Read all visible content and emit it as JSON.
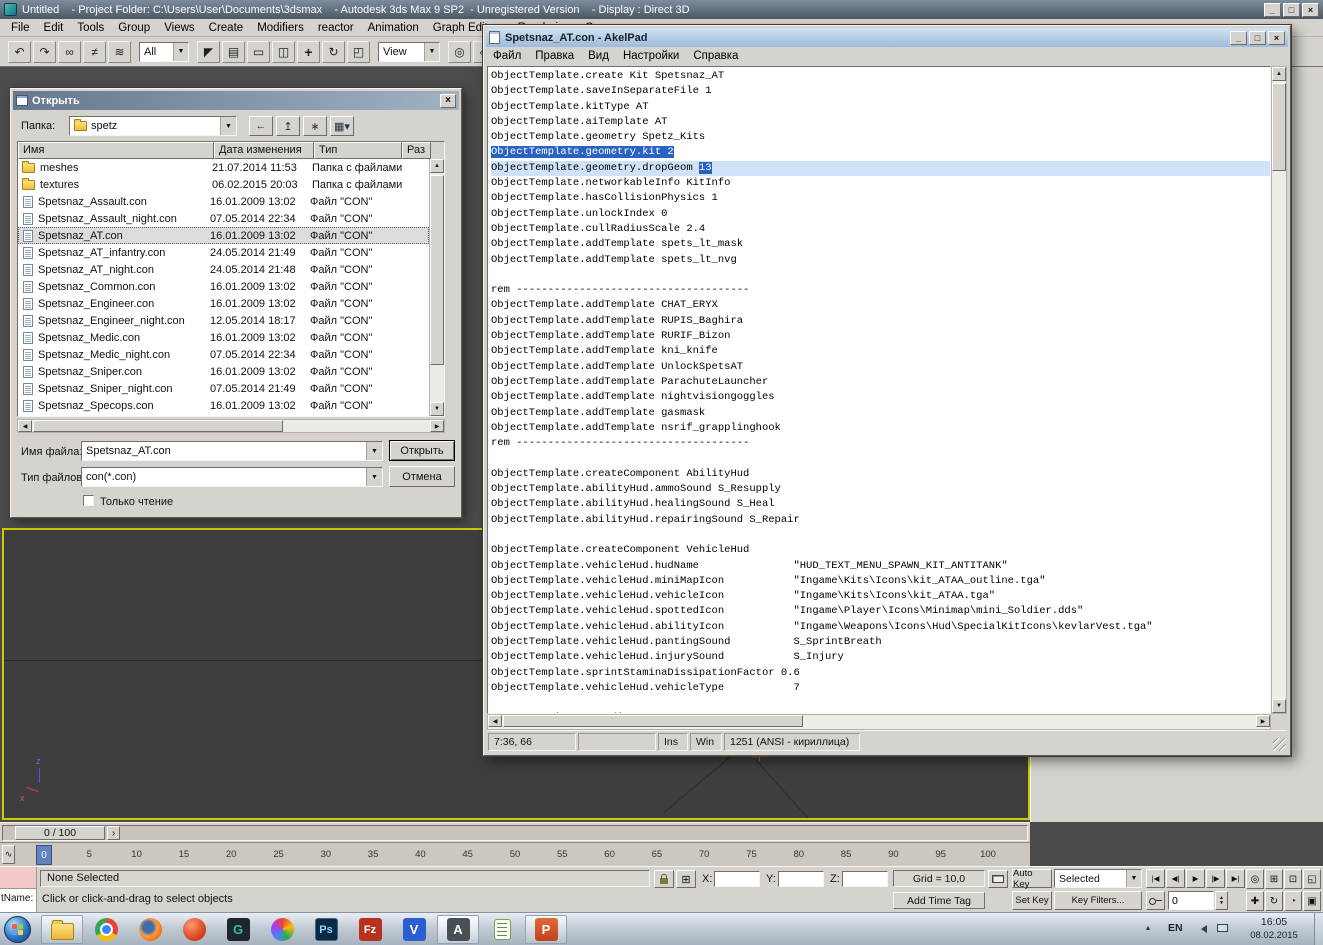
{
  "colors": {
    "selection_blue": "#2a62c4",
    "active_line_blue": "#cfe2f7",
    "viewport_active_border": "#cccc00"
  },
  "max_window": {
    "title": "Untitled    - Project Folder: C:\\Users\\User\\Documents\\3dsmax    - Autodesk 3ds Max 9 SP2  - Unregistered Version    - Display : Direct 3D",
    "window_buttons": {
      "minimize": "_",
      "maximize": "□",
      "close": "×"
    },
    "menu_items": [
      "File",
      "Edit",
      "Tools",
      "Group",
      "Views",
      "Create",
      "Modifiers",
      "reactor",
      "Animation",
      "Graph Editors",
      "Rendering",
      "Cu"
    ],
    "toolbar": {
      "group1": [
        {
          "name": "undo",
          "glyph": "↶"
        },
        {
          "name": "redo",
          "glyph": "↷"
        },
        {
          "name": "select-and-link",
          "glyph": "∞"
        },
        {
          "name": "unlink-selection",
          "glyph": "≠"
        },
        {
          "name": "bind-to-space-warp",
          "glyph": "≋"
        }
      ],
      "selection_filter_value": "All",
      "group2": [
        {
          "name": "select-object",
          "glyph": "◤"
        },
        {
          "name": "select-by-name",
          "glyph": "▤"
        },
        {
          "name": "rectangular-selection-region",
          "glyph": "▭"
        },
        {
          "name": "window-crossing-toggle",
          "glyph": "◫"
        },
        {
          "name": "select-and-move",
          "glyph": "+",
          "cls": "bold"
        },
        {
          "name": "select-and-rotate",
          "glyph": "↻"
        },
        {
          "name": "select-and-uniform-scale",
          "glyph": "◰"
        }
      ],
      "coordsys_value": "View",
      "group3": [
        {
          "name": "use-pivot-point-center",
          "glyph": "◎"
        },
        {
          "name": "select-and-manipulate",
          "glyph": "◇"
        }
      ]
    },
    "time_slider_label": "0 / 100",
    "trackbar": {
      "frame_marker": "0",
      "ticks": [
        5,
        10,
        15,
        20,
        25,
        30,
        35,
        40,
        45,
        50,
        55,
        60,
        65,
        70,
        75,
        80,
        85,
        90,
        95,
        100
      ]
    },
    "mini_listener_text": "tName: (bf",
    "status": {
      "selection_status": "None Selected",
      "prompt": "Click or click-and-drag to select objects",
      "x_label": "X:",
      "y_label": "Y:",
      "z_label": "Z:",
      "grid_value": "Grid = 10,0",
      "add_time_tag": "Add Time Tag",
      "auto_key": "Auto Key",
      "set_key": "Set Key",
      "key_mode_value": "Selected",
      "key_filters": "Key Filters...",
      "time_value": "0",
      "playback": [
        {
          "name": "go-to-start",
          "glyph": "|◀"
        },
        {
          "name": "previous-frame",
          "glyph": "◀|"
        },
        {
          "name": "play-animation",
          "glyph": "▶"
        },
        {
          "name": "next-frame",
          "glyph": "|▶"
        },
        {
          "name": "go-to-end",
          "glyph": "▶|"
        }
      ],
      "nav_row1": [
        {
          "name": "zoom",
          "glyph": "◎"
        },
        {
          "name": "zoom-all",
          "glyph": "⊞"
        },
        {
          "name": "zoom-extents",
          "glyph": "⊡"
        },
        {
          "name": "zoom-region",
          "glyph": "◱"
        }
      ],
      "nav_row2": [
        {
          "name": "pan-view",
          "glyph": "✚"
        },
        {
          "name": "orbit-view",
          "glyph": "↻"
        },
        {
          "name": "field-of-view",
          "glyph": "◔"
        },
        {
          "name": "maximize-viewport-toggle",
          "glyph": "▣"
        }
      ]
    },
    "viewport": {
      "axis_z": "z",
      "axis_x": "x"
    }
  },
  "open_dialog": {
    "title": "Открыть",
    "close_button": "×",
    "folder_label": "Папка:",
    "folder_value": "spetz",
    "nav_buttons": [
      {
        "name": "back",
        "glyph": "←"
      },
      {
        "name": "up-one-level",
        "glyph": "↥"
      },
      {
        "name": "create-new-folder",
        "glyph": "∗"
      },
      {
        "name": "view-menu",
        "glyph": "▦▾"
      }
    ],
    "columns": [
      "Имя",
      "Дата изменения",
      "Тип",
      "Раз"
    ],
    "files": [
      {
        "name": "meshes",
        "date": "21.07.2014 11:53",
        "type": "Папка с файлами",
        "icon": "folder"
      },
      {
        "name": "textures",
        "date": "06.02.2015 20:03",
        "type": "Папка с файлами",
        "icon": "folder"
      },
      {
        "name": "Spetsnaz_Assault.con",
        "date": "16.01.2009 13:02",
        "type": "Файл \"CON\"",
        "icon": "file"
      },
      {
        "name": "Spetsnaz_Assault_night.con",
        "date": "07.05.2014 22:34",
        "type": "Файл \"CON\"",
        "icon": "file"
      },
      {
        "name": "Spetsnaz_AT.con",
        "date": "16.01.2009 13:02",
        "type": "Файл \"CON\"",
        "icon": "file",
        "selected": true
      },
      {
        "name": "Spetsnaz_AT_infantry.con",
        "date": "24.05.2014 21:49",
        "type": "Файл \"CON\"",
        "icon": "file"
      },
      {
        "name": "Spetsnaz_AT_night.con",
        "date": "24.05.2014 21:48",
        "type": "Файл \"CON\"",
        "icon": "file"
      },
      {
        "name": "Spetsnaz_Common.con",
        "date": "16.01.2009 13:02",
        "type": "Файл \"CON\"",
        "icon": "file"
      },
      {
        "name": "Spetsnaz_Engineer.con",
        "date": "16.01.2009 13:02",
        "type": "Файл \"CON\"",
        "icon": "file"
      },
      {
        "name": "Spetsnaz_Engineer_night.con",
        "date": "12.05.2014 18:17",
        "type": "Файл \"CON\"",
        "icon": "file"
      },
      {
        "name": "Spetsnaz_Medic.con",
        "date": "16.01.2009 13:02",
        "type": "Файл \"CON\"",
        "icon": "file"
      },
      {
        "name": "Spetsnaz_Medic_night.con",
        "date": "07.05.2014 22:34",
        "type": "Файл \"CON\"",
        "icon": "file"
      },
      {
        "name": "Spetsnaz_Sniper.con",
        "date": "16.01.2009 13:02",
        "type": "Файл \"CON\"",
        "icon": "file"
      },
      {
        "name": "Spetsnaz_Sniper_night.con",
        "date": "07.05.2014 21:49",
        "type": "Файл \"CON\"",
        "icon": "file"
      },
      {
        "name": "Spetsnaz_Specops.con",
        "date": "16.01.2009 13:02",
        "type": "Файл \"CON\"",
        "icon": "file"
      }
    ],
    "filename_label": "Имя файла:",
    "filename_value": "Spetsnaz_AT.con",
    "filetype_label": "Тип файлов:",
    "filetype_value": "con(*.con)",
    "open_button": "Открыть",
    "cancel_button": "Отмена",
    "readonly_checkbox_label": "Только чтение"
  },
  "akelpad": {
    "title": "Spetsnaz_AT.con - AkelPad",
    "window_buttons": {
      "minimize": "_",
      "maximize": "□",
      "close": "×"
    },
    "menu_items": [
      "Файл",
      "Правка",
      "Вид",
      "Настройки",
      "Справка"
    ],
    "lines": [
      "ObjectTemplate.create Kit Spetsnaz_AT",
      "ObjectTemplate.saveInSeparateFile 1",
      "ObjectTemplate.kitType AT",
      "ObjectTemplate.aiTemplate AT",
      "ObjectTemplate.geometry Spetz_Kits",
      "ObjectTemplate.geometry.kit 2",
      "ObjectTemplate.geometry.dropGeom 13",
      "ObjectTemplate.networkableInfo KitInfo",
      "ObjectTemplate.hasCollisionPhysics 1",
      "ObjectTemplate.unlockIndex 0",
      "ObjectTemplate.cullRadiusScale 2.4",
      "ObjectTemplate.addTemplate spets_lt_mask",
      "ObjectTemplate.addTemplate spets_lt_nvg",
      "",
      "rem -------------------------------------",
      "ObjectTemplate.addTemplate CHAT_ERYX",
      "ObjectTemplate.addTemplate RUPIS_Baghira",
      "ObjectTemplate.addTemplate RURIF_Bizon",
      "ObjectTemplate.addTemplate kni_knife",
      "ObjectTemplate.addTemplate UnlockSpetsAT",
      "ObjectTemplate.addTemplate ParachuteLauncher",
      "ObjectTemplate.addTemplate nightvisiongoggles",
      "ObjectTemplate.addTemplate gasmask",
      "ObjectTemplate.addTemplate nsrif_grapplinghook",
      "rem -------------------------------------",
      "",
      "ObjectTemplate.createComponent AbilityHud",
      "ObjectTemplate.abilityHud.ammoSound S_Resupply",
      "ObjectTemplate.abilityHud.healingSound S_Heal",
      "ObjectTemplate.abilityHud.repairingSound S_Repair",
      "",
      "ObjectTemplate.createComponent VehicleHud",
      "ObjectTemplate.vehicleHud.hudName               \"HUD_TEXT_MENU_SPAWN_KIT_ANTITANK\"",
      "ObjectTemplate.vehicleHud.miniMapIcon           \"Ingame\\Kits\\Icons\\kit_ATAA_outline.tga\"",
      "ObjectTemplate.vehicleHud.vehicleIcon           \"Ingame\\Kits\\Icons\\kit_ATAA.tga\"",
      "ObjectTemplate.vehicleHud.spottedIcon           \"Ingame\\Player\\Icons\\Minimap\\mini_Soldier.dds\"",
      "ObjectTemplate.vehicleHud.abilityIcon           \"Ingame\\Weapons\\Icons\\Hud\\SpecialKitIcons\\kevlarVest.tga\"",
      "ObjectTemplate.vehicleHud.pantingSound          S_SprintBreath",
      "ObjectTemplate.vehicleHud.injurySound           S_Injury",
      "ObjectTemplate.sprintStaminaDissipationFactor 0.6",
      "ObjectTemplate.vehicleHud.vehicleType           7",
      "",
      "rem ---BeginComp:Radio ---"
    ],
    "selection": {
      "selected_line_index": 5,
      "caret_line_index": 6,
      "caret_line_prefix": "ObjectTemplate.geometry.dropGeom ",
      "caret_line_selected_text": "13"
    },
    "status": {
      "position": "7:36, 66",
      "insert_mode": "Ins",
      "newline_format": "Win",
      "encoding": "1251 (ANSI - кириллица)"
    }
  },
  "taskbar": {
    "items": [
      {
        "name": "start-button",
        "kind": "start",
        "label": ""
      },
      {
        "name": "explorer",
        "kind": "folder",
        "label": "",
        "open": true
      },
      {
        "name": "browser-chrome",
        "kind": "chrome",
        "label": ""
      },
      {
        "name": "browser-firefox",
        "kind": "firefox",
        "label": ""
      },
      {
        "name": "browser-opera",
        "kind": "opera",
        "label": ""
      },
      {
        "name": "app-g",
        "kind": "gapp",
        "label": "G"
      },
      {
        "name": "app-3dsmax",
        "kind": "pinwheel",
        "label": ""
      },
      {
        "name": "photoshop",
        "kind": "ps",
        "label": "Ps"
      },
      {
        "name": "filezilla",
        "kind": "fz",
        "label": "Fz"
      },
      {
        "name": "app-v",
        "kind": "vapp",
        "label": "V"
      },
      {
        "name": "akelpad",
        "kind": "akel",
        "label": "A",
        "open": true,
        "active": true
      },
      {
        "name": "notepad",
        "kind": "note",
        "label": ""
      },
      {
        "name": "powerpoint",
        "kind": "ppt",
        "label": "P",
        "open": true
      }
    ],
    "tray": {
      "chevron": "▴",
      "language": "EN",
      "time": "16:05",
      "date": "08.02.2015"
    }
  }
}
